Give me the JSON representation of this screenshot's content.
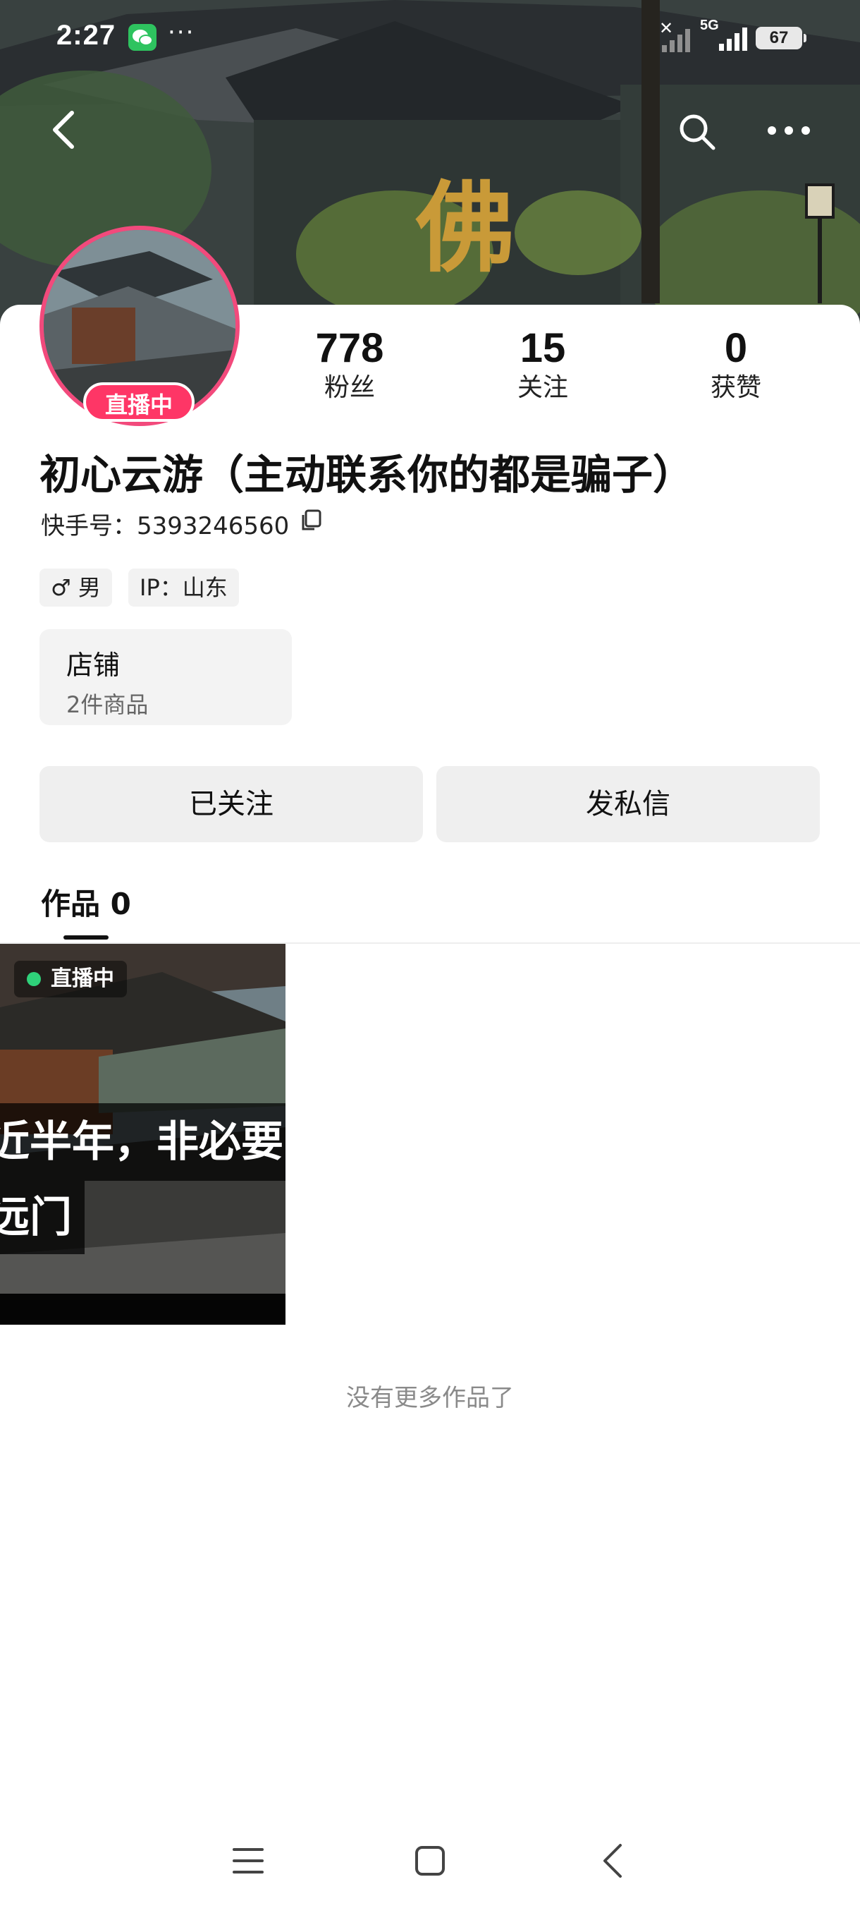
{
  "status_bar": {
    "time": "2:27",
    "more": "···",
    "network": "5G",
    "battery": "67"
  },
  "header": {
    "banner_text": "佛"
  },
  "profile": {
    "live_badge": "直播中",
    "stats": [
      {
        "value": "778",
        "label": "粉丝"
      },
      {
        "value": "15",
        "label": "关注"
      },
      {
        "value": "0",
        "label": "获赞"
      }
    ],
    "nickname": "初心云游（主动联系你的都是骗子）",
    "kuaishou_id": "快手号：5393246560",
    "tags": {
      "gender": "♂ 男",
      "ip": "IP：山东"
    },
    "shop": {
      "title": "店铺",
      "subtitle": "2件商品"
    },
    "buttons": {
      "followed": "已关注",
      "message": "发私信"
    }
  },
  "works": {
    "tab_label": "作品 0",
    "item": {
      "live_label": "直播中",
      "caption_line1": "近半年，非必要",
      "caption_line2": "远门"
    },
    "no_more": "没有更多作品了"
  },
  "colors": {
    "accent": "#fe3666",
    "live_dot": "#2fd17a",
    "button_bg": "#efefef"
  }
}
